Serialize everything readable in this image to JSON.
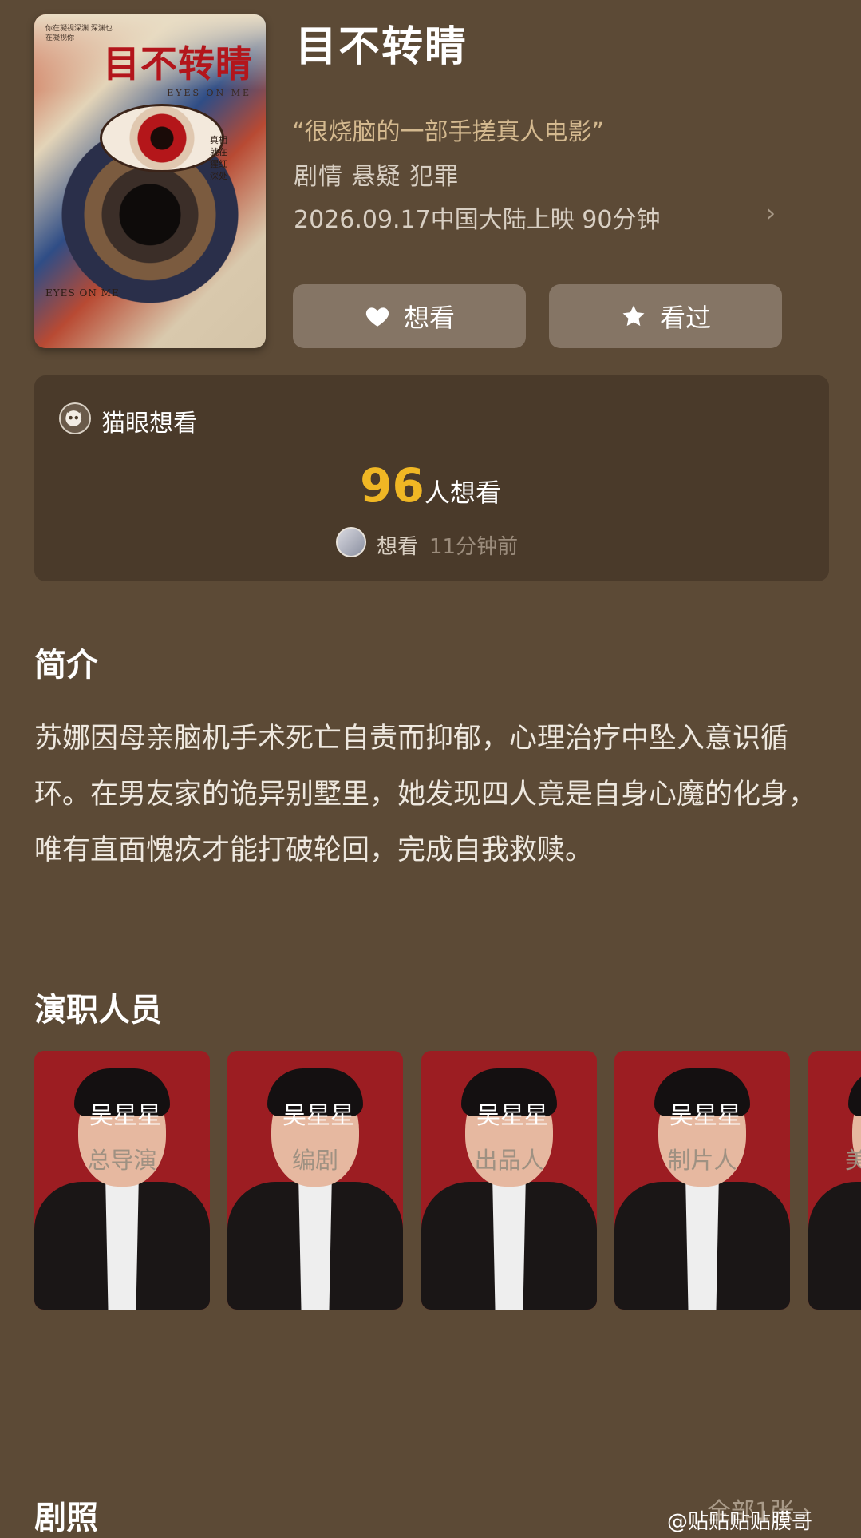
{
  "poster": {
    "title": "目不转睛",
    "subtitle": "EYES ON ME",
    "tagline": "你在凝视深渊 深渊也在凝视你",
    "side_text": "真相就在猩红深处",
    "footer": "EYES ON ME"
  },
  "movie": {
    "title": "目不转睛",
    "quote": "“很烧脑的一部手搓真人电影”",
    "genres": "剧情 悬疑 犯罪",
    "release": "2026.09.17中国大陆上映 90分钟"
  },
  "actions": {
    "want_label": "想看",
    "seen_label": "看过"
  },
  "want_card": {
    "source_label": "猫眼想看",
    "count": "96",
    "count_suffix": "人想看",
    "recent_action": "想看",
    "recent_time": "11分钟前"
  },
  "intro": {
    "heading": "简介",
    "text": "苏娜因母亲脑机手术死亡自责而抑郁，心理治疗中坠入意识循环。在男友家的诡异别墅里，她发现四人竟是自身心魔的化身，唯有直面愧疚才能打破轮回，完成自我救赎。"
  },
  "cast": {
    "heading": "演职人员",
    "members": [
      {
        "name": "吴星星",
        "role": "总导演"
      },
      {
        "name": "吴星星",
        "role": "编剧"
      },
      {
        "name": "吴星星",
        "role": "出品人"
      },
      {
        "name": "吴星星",
        "role": "制片人"
      },
      {
        "name": "",
        "role": "美"
      }
    ]
  },
  "stills": {
    "heading": "剧照",
    "all_label": "全部1张 ›"
  },
  "watermark": "@贴贴贴贴膜哥",
  "colors": {
    "background": "#5c4a36",
    "card": "#4a3a2a",
    "button": "#857565",
    "accent_count": "#f0b724",
    "quote": "#d4b98f"
  }
}
